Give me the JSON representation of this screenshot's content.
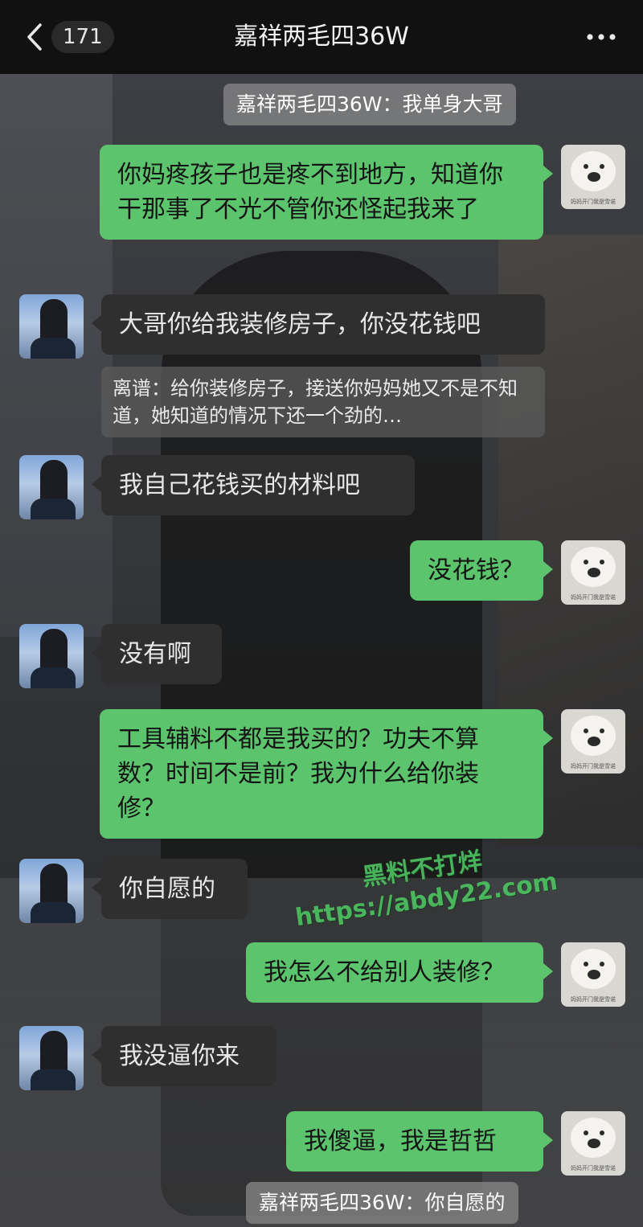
{
  "header": {
    "back_count": "171",
    "title": "嘉祥两毛四36W"
  },
  "messages": [
    {
      "kind": "system",
      "text": "嘉祥两毛四36W：我单身大哥"
    },
    {
      "kind": "me",
      "text": "你妈疼孩子也是疼不到地方，知道你干那事了不光不管你还怪起我来了"
    },
    {
      "kind": "them",
      "text": "大哥你给我装修房子，你没花钱吧"
    },
    {
      "kind": "quote",
      "text": "离谱：给你装修房子，接送你妈妈她又不是不知道，她知道的情况下还一个劲的…"
    },
    {
      "kind": "them",
      "text": "我自己花钱买的材料吧"
    },
    {
      "kind": "me",
      "text": "没花钱？"
    },
    {
      "kind": "them",
      "text": "没有啊"
    },
    {
      "kind": "me",
      "text": "工具辅料不都是我买的？功夫不算数？时间不是前？我为什么给你装修？"
    },
    {
      "kind": "them",
      "text": "你自愿的"
    },
    {
      "kind": "me",
      "text": "我怎么不给别人装修？"
    },
    {
      "kind": "them",
      "text": "我没逼你来"
    },
    {
      "kind": "me",
      "text": "我傻逼，我是哲哲"
    },
    {
      "kind": "system",
      "text": "嘉祥两毛四36W：你自愿的"
    }
  ],
  "my_avatar_caption": "妈妈开门我是雪诺",
  "watermark": {
    "line1": "黑料不打烊",
    "line2": "https://abdy22.com"
  },
  "colors": {
    "my_bubble": "#5dc46e",
    "their_bubble": "#2f2f2f",
    "top_bar": "#111111"
  }
}
